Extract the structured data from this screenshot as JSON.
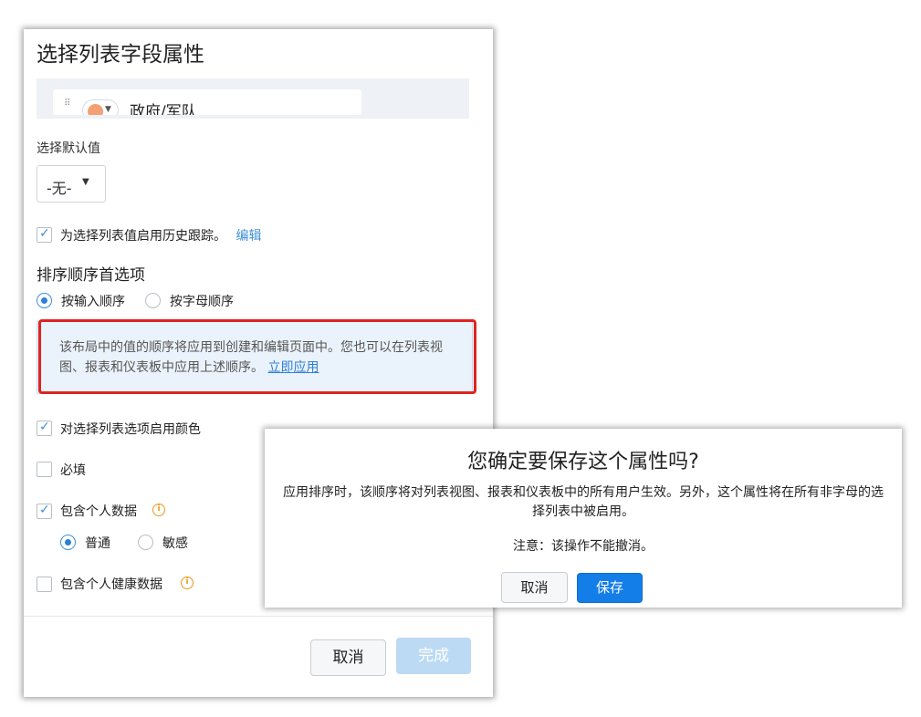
{
  "panel": {
    "title": "选择列表字段属性",
    "picklist_item": {
      "text": "政府/军队",
      "drag_glyph": "⠿",
      "color": "#f4a074"
    },
    "default_value": {
      "label": "选择默认值",
      "selected": "-无-"
    },
    "history": {
      "checked": true,
      "label": "为选择列表值启用历史跟踪。",
      "link": "编辑"
    },
    "sort": {
      "title": "排序顺序首选项",
      "options": [
        {
          "label": "按输入顺序",
          "selected": true
        },
        {
          "label": "按字母顺序",
          "selected": false
        }
      ],
      "info_text": "该布局中的值的顺序将应用到创建和编辑页面中。您也可以在列表视图、报表和仪表板中应用上述顺序。",
      "info_link": "立即应用"
    },
    "options": {
      "color": {
        "checked": true,
        "label": "对选择列表选项启用颜色"
      },
      "required": {
        "checked": false,
        "label": "必填"
      },
      "personal": {
        "checked": true,
        "label": "包含个人数据",
        "sub_options": [
          {
            "label": "普通",
            "selected": true
          },
          {
            "label": "敏感",
            "selected": false
          }
        ]
      },
      "health": {
        "checked": false,
        "label": "包含个人健康数据"
      }
    },
    "buttons": {
      "cancel": "取消",
      "done": "完成"
    }
  },
  "dialog": {
    "title": "您确定要保存这个属性吗?",
    "message": "应用排序时，该顺序将对列表视图、报表和仪表板中的所有用户生效。另外，这个属性将在所有非字母的选择列表中被启用。",
    "note": "注意：该操作不能撤消。",
    "buttons": {
      "cancel": "取消",
      "save": "保存"
    }
  },
  "colors": {
    "accent": "#3e8fd8",
    "primary_button": "#137de8",
    "highlight": "#e02222",
    "info_bg": "#eaf3fb"
  }
}
